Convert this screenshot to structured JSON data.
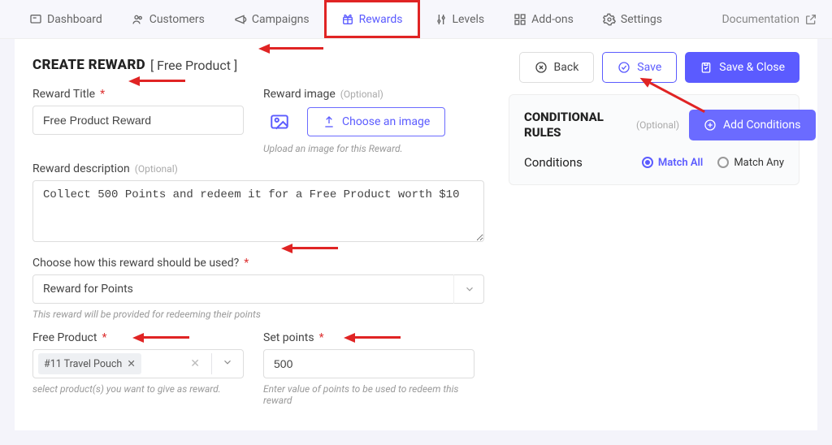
{
  "nav": {
    "items": [
      {
        "label": "Dashboard"
      },
      {
        "label": "Customers"
      },
      {
        "label": "Campaigns"
      },
      {
        "label": "Rewards",
        "active": true
      },
      {
        "label": "Levels"
      },
      {
        "label": "Add-ons"
      },
      {
        "label": "Settings"
      }
    ],
    "doc_label": "Documentation"
  },
  "header": {
    "title": "CREATE REWARD",
    "subtitle": "[ Free Product ]"
  },
  "actions": {
    "back": "Back",
    "save": "Save",
    "save_close": "Save & Close"
  },
  "form": {
    "reward_title": {
      "label": "Reward Title",
      "value": "Free Product Reward"
    },
    "reward_image": {
      "label": "Reward image",
      "optional": "(Optional)",
      "button": "Choose an image",
      "hint": "Upload an image for this Reward."
    },
    "description": {
      "label": "Reward description",
      "optional": "(Optional)",
      "value": "Collect 500 Points and redeem it for a Free Product worth $10"
    },
    "use_mode": {
      "label": "Choose how this reward should be used?",
      "value": "Reward for Points",
      "hint": "This reward will be provided for redeeming their points"
    },
    "free_product": {
      "label": "Free Product",
      "tag": "#11 Travel Pouch",
      "hint": "select product(s) you want to give as reward."
    },
    "set_points": {
      "label": "Set points",
      "value": "500",
      "hint": "Enter value of points to be used to redeem this reward"
    }
  },
  "conditions": {
    "title": "CONDITIONAL RULES",
    "optional": "(Optional)",
    "add_btn": "Add Conditions",
    "section_label": "Conditions",
    "match_all": "Match All",
    "match_any": "Match Any",
    "selected": "all"
  }
}
